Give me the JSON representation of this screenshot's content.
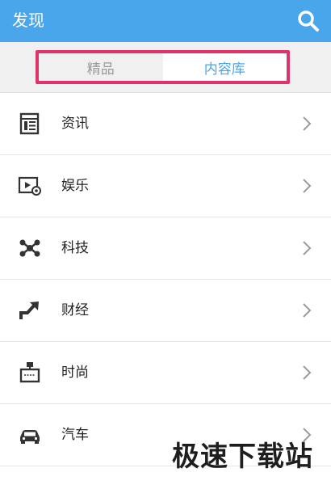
{
  "header": {
    "title": "发现",
    "search_icon": "search-icon",
    "background_color": "#4aa6eb"
  },
  "tabs": [
    {
      "label": "精品",
      "active": false
    },
    {
      "label": "内容库",
      "active": true
    }
  ],
  "highlight_color": "#e0336a",
  "categories": [
    {
      "label": "资讯",
      "icon": "news-icon"
    },
    {
      "label": "娱乐",
      "icon": "video-play-icon"
    },
    {
      "label": "科技",
      "icon": "molecule-icon"
    },
    {
      "label": "财经",
      "icon": "trend-arrow-icon"
    },
    {
      "label": "时尚",
      "icon": "sign-board-icon"
    },
    {
      "label": "汽车",
      "icon": "car-icon"
    }
  ],
  "watermark": "极速下载站"
}
